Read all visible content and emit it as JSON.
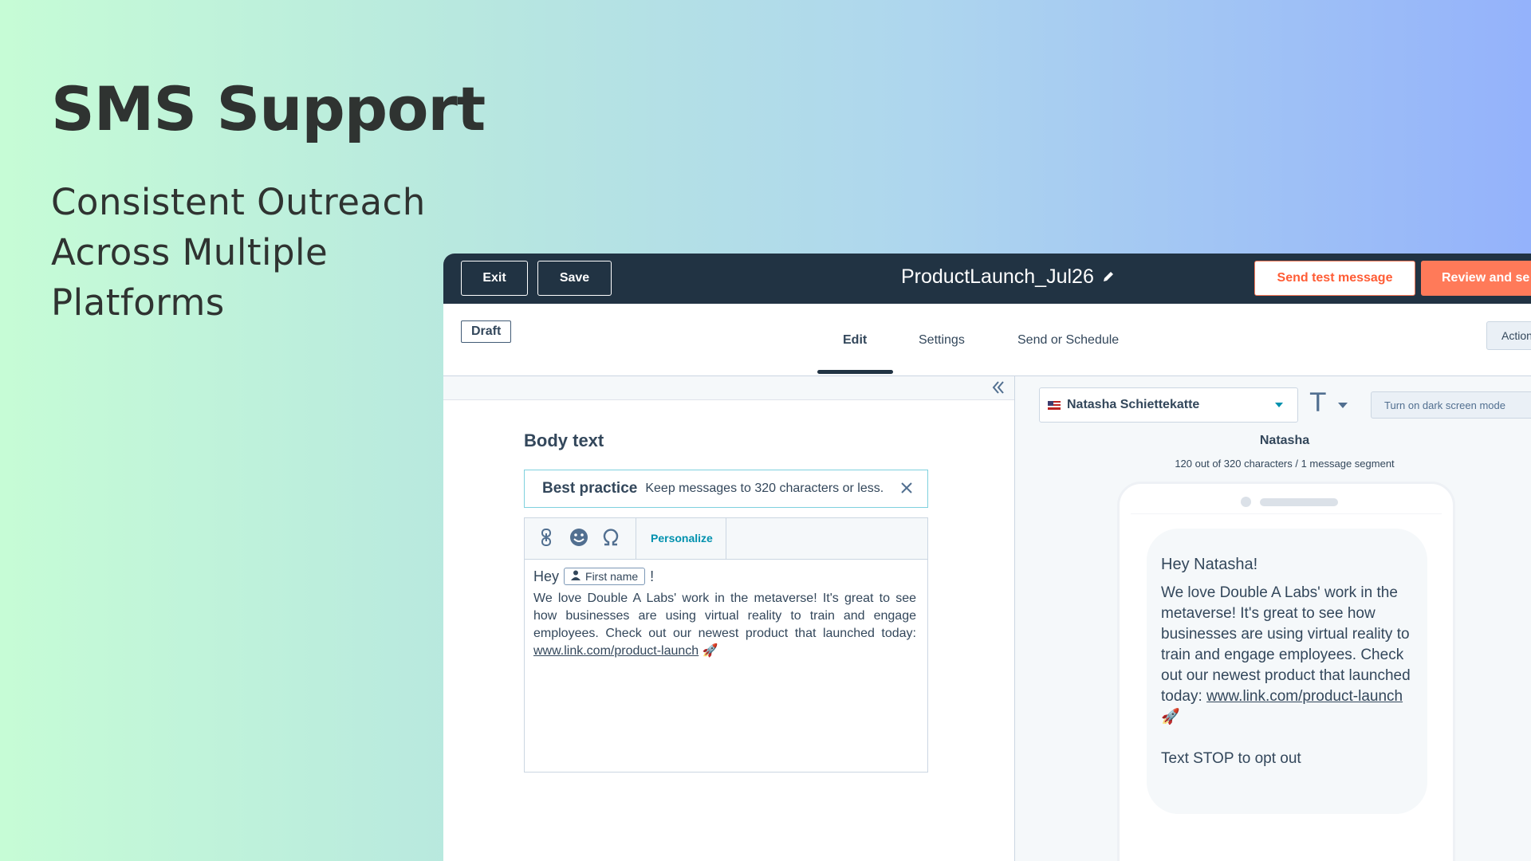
{
  "hero": {
    "title": "SMS Support",
    "subtitle": "Consistent Outreach Across Multiple Platforms"
  },
  "topbar": {
    "exit_label": "Exit",
    "save_label": "Save",
    "document_title": "ProductLaunch_Jul26",
    "edit_icon": "pencil-icon",
    "send_test_label": "Send test message",
    "review_label": "Review and se"
  },
  "tabs": {
    "status_badge": "Draft",
    "items": [
      {
        "label": "Edit",
        "active": true
      },
      {
        "label": "Settings",
        "active": false
      },
      {
        "label": "Send or Schedule",
        "active": false
      }
    ],
    "actions_label": "Action"
  },
  "editor": {
    "body_label": "Body text",
    "best_practice_title": "Best practice",
    "best_practice_message": "Keep messages to 320 characters or less.",
    "toolbar_icons": [
      "link-icon",
      "emoji-icon",
      "special-character-icon"
    ],
    "personalize_label": "Personalize",
    "greeting": "Hey",
    "token_label": "First name",
    "greeting_punct": "!",
    "body_text": "We love Double A Labs' work in the metaverse! It's great to see how businesses are using virtual reality to train and engage employees. Check out our newest product that launched today:",
    "link_text": "www.link.com/product-launch",
    "emoji": "🚀"
  },
  "preview": {
    "contact_name": "Natasha Schiettekatte",
    "dark_mode_label": "Turn on dark screen mode",
    "recipient_first_name": "Natasha",
    "char_count": "120 out of 320 characters / 1 message segment",
    "greeting": "Hey Natasha!",
    "body_text": "We love Double A Labs' work in the metaverse! It's great to see how businesses are using virtual reality to train and engage employees. Check out our newest product that launched today:",
    "link_text": "www.link.com/product-launch",
    "emoji": "🚀",
    "opt_out": "Text STOP to opt out"
  },
  "colors": {
    "topbar_bg": "#213343",
    "accent_orange": "#ff7a59",
    "accent_teal": "#0091ae"
  }
}
